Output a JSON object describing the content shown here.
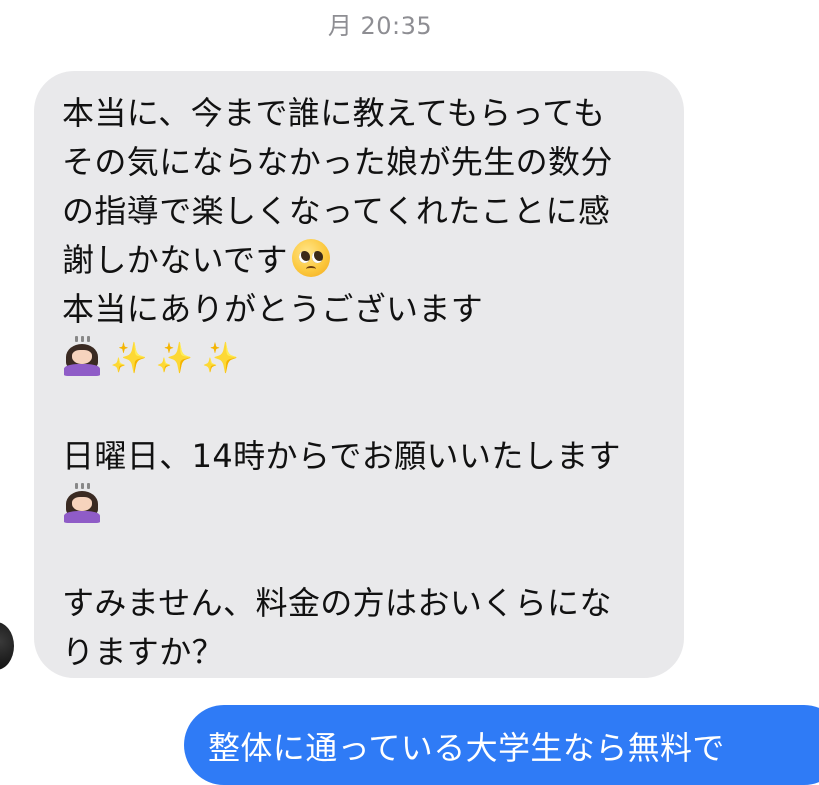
{
  "header": {
    "timestamp": "月 20:35"
  },
  "incoming_message": {
    "lines": [
      "本当に、今まで誰に教えてもらっても",
      "その気にならなかった娘が先生の数分",
      "の指導で楽しくなってくれたことに感",
      "謝しかないです",
      "本当にありがとうございます",
      "",
      "",
      "日曜日、14時からでお願いいたします",
      "",
      "",
      "すみません、料金の方はおいくらにな",
      "りますか？"
    ],
    "emojis": {
      "line4": "pleading-face",
      "line6": [
        "person-bowing",
        "sparkles",
        "sparkles",
        "sparkles"
      ],
      "line9": "person-bowing"
    },
    "sparkle_glyph": "✨",
    "bubble_color": "#e9e9eb"
  },
  "outgoing_message": {
    "text_partial": "整体に通っている大学生なら無料で",
    "bubble_color": "#2f7bf6"
  }
}
